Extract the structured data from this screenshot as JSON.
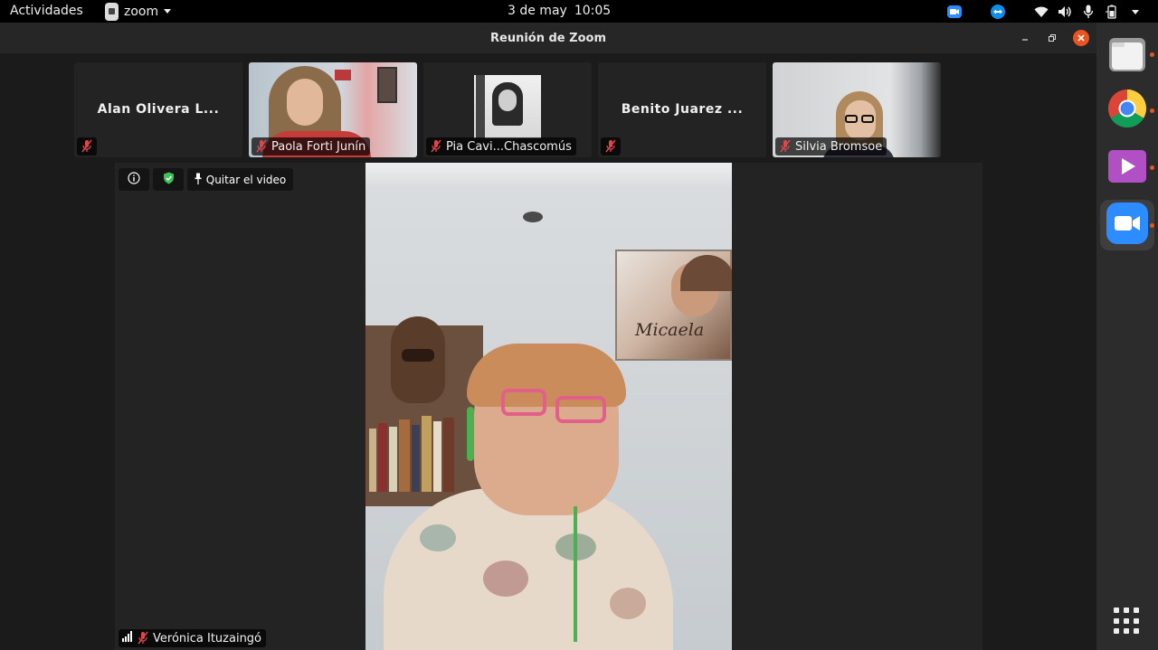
{
  "topbar": {
    "activities_label": "Actividades",
    "app_name": "zoom",
    "date": "3 de may",
    "time": "10:05",
    "tray_icons": [
      "zoom-tray-icon",
      "teamviewer-icon",
      "wifi-icon",
      "volume-icon",
      "microphone-icon",
      "battery-icon",
      "menu-caret-icon"
    ]
  },
  "window": {
    "title": "Reunión de Zoom"
  },
  "participants": [
    {
      "name": "Alan Olivera L...",
      "video": false,
      "muted": true
    },
    {
      "name": "Paola Forti Junín",
      "video": true,
      "muted": true
    },
    {
      "name": "Pia Cavi...Chascomús",
      "video": true,
      "muted": true
    },
    {
      "name": "Benito Juarez ...",
      "video": false,
      "muted": true
    },
    {
      "name": "Silvia Bromsoe",
      "video": true,
      "muted": true
    }
  ],
  "main_stage": {
    "info_icon": "info-icon",
    "security_icon": "shield-check-icon",
    "unpin_label": "Quitar el video",
    "speaker_name": "Verónica Ituzaingó",
    "poster_text": "Micaela"
  },
  "dock": {
    "items": [
      "files-icon",
      "chrome-icon",
      "video-player-icon",
      "zoom-app-icon"
    ],
    "show_apps_icon": "app-grid-icon"
  },
  "colors": {
    "accent": "#e95420",
    "muted_red": "#e0454b",
    "shield_green": "#3ac451",
    "zoom_blue": "#2d8cff"
  }
}
